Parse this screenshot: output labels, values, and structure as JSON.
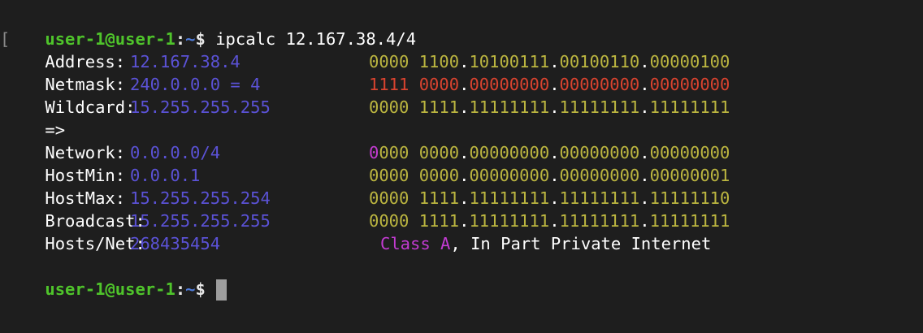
{
  "prompt": {
    "user_host": "user-1@user-1",
    "separator": ":",
    "path": "~",
    "symbol": "$"
  },
  "command": "ipcalc 12.167.38.4/4",
  "rows": [
    {
      "label": "Address:",
      "value": "12.167.38.4",
      "bin_a": "0000 1100",
      "bin_b": "10100111",
      "bin_c": "00100110",
      "bin_d": "00000100"
    },
    {
      "label": "Netmask:",
      "value": "240.0.0.0 = 4",
      "bin_a": "1111 0000",
      "bin_b": "00000000",
      "bin_c": "00000000",
      "bin_d": "00000000"
    },
    {
      "label": "Wildcard:",
      "value": "15.255.255.255",
      "bin_a": "0000 1111",
      "bin_b": "11111111",
      "bin_c": "11111111",
      "bin_d": "11111111"
    },
    {
      "label": "=>"
    },
    {
      "label": "Network:",
      "value": "0.0.0.0/4",
      "bin_first": "0",
      "bin_a": "000 0000",
      "bin_b": "00000000",
      "bin_c": "00000000",
      "bin_d": "00000000"
    },
    {
      "label": "HostMin:",
      "value": "0.0.0.1",
      "bin_a": "0000 0000",
      "bin_b": "00000000",
      "bin_c": "00000000",
      "bin_d": "00000001"
    },
    {
      "label": "HostMax:",
      "value": "15.255.255.254",
      "bin_a": "0000 1111",
      "bin_b": "11111111",
      "bin_c": "11111111",
      "bin_d": "11111110"
    },
    {
      "label": "Broadcast:",
      "value": "15.255.255.255",
      "bin_a": "0000 1111",
      "bin_b": "11111111",
      "bin_c": "11111111",
      "bin_d": "11111111"
    },
    {
      "label": "Hosts/Net:",
      "value": "268435454",
      "class_label": "Class A",
      "class_rest": ", In Part Private Internet"
    }
  ],
  "octet_separator": ".",
  "colors": {
    "background": "#1e1e1e",
    "prompt_user": "#4fc42b",
    "prompt_path": "#4f7bd8",
    "value": "#5b52d6",
    "binary": "#bcb640",
    "netmask_binary": "#d9432f",
    "highlight": "#c33bd2",
    "cursor": "#9e9e9e"
  }
}
